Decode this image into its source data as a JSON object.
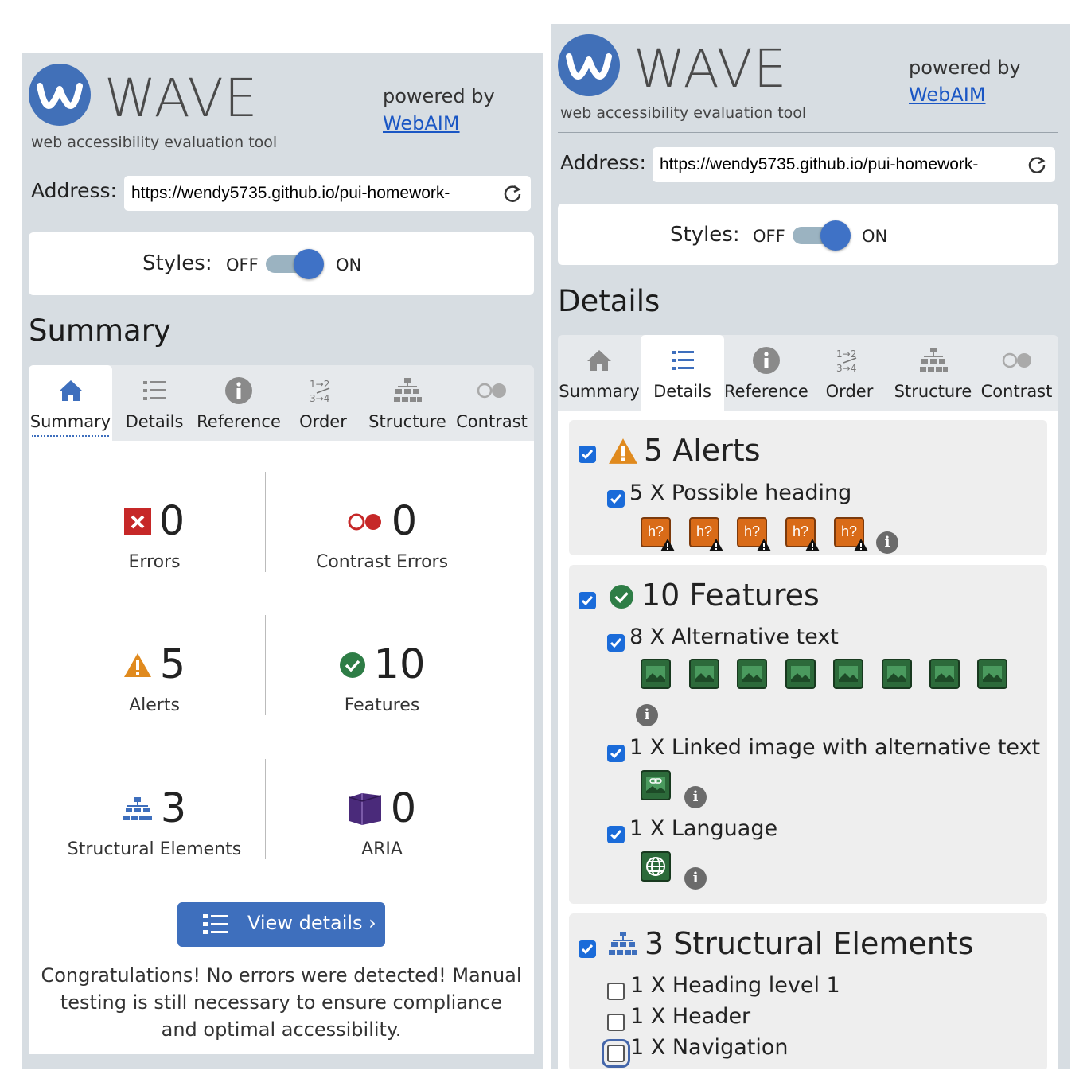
{
  "app": {
    "title": "WAVE",
    "tagline": "web accessibility evaluation tool",
    "powered_by": "powered by",
    "webaim_link": "WebAIM"
  },
  "address": {
    "label": "Address:",
    "url": "https://wendy5735.github.io/pui-homework-"
  },
  "styles": {
    "label": "Styles:",
    "off": "OFF",
    "on": "ON",
    "state": "on"
  },
  "tabs": [
    "Summary",
    "Details",
    "Reference",
    "Order",
    "Structure",
    "Contrast"
  ],
  "summary_panel": {
    "heading": "Summary",
    "active_tab": "Summary",
    "stats": [
      {
        "label": "Errors",
        "value": "0",
        "icon": "error-x-icon"
      },
      {
        "label": "Contrast Errors",
        "value": "0",
        "icon": "contrast-icon"
      },
      {
        "label": "Alerts",
        "value": "5",
        "icon": "alert-triangle-icon"
      },
      {
        "label": "Features",
        "value": "10",
        "icon": "check-circle-icon"
      },
      {
        "label": "Structural Elements",
        "value": "3",
        "icon": "structure-icon"
      },
      {
        "label": "ARIA",
        "value": "0",
        "icon": "aria-cube-icon"
      }
    ],
    "view_details": "View details ›",
    "congrats": "Congratulations! No errors were detected! Manual testing is still necessary to ensure compliance and optimal accessibility."
  },
  "details_panel": {
    "heading": "Details",
    "active_tab": "Details",
    "alerts": {
      "title": "5 Alerts",
      "items": [
        {
          "label": "5 X Possible heading",
          "count": 5,
          "chip_text": "h?"
        }
      ]
    },
    "features": {
      "title": "10 Features",
      "items": [
        {
          "label": "8 X Alternative text",
          "count": 8
        },
        {
          "label": "1 X Linked image with alternative text",
          "count": 1
        },
        {
          "label": "1 X Language",
          "count": 1
        }
      ]
    },
    "structure": {
      "title": "3 Structural Elements",
      "items": [
        {
          "label": "1 X Heading level 1",
          "checked": false
        },
        {
          "label": "1 X Header",
          "checked": false
        },
        {
          "label": "1 X Navigation",
          "checked": false
        }
      ]
    }
  },
  "colors": {
    "panel_bg": "#d7dde2",
    "brand_blue": "#4170b8",
    "alert_orange": "#d96b18",
    "feature_green": "#2c6a3a",
    "error_red": "#c62828",
    "aria_purple": "#4a2a7a"
  }
}
